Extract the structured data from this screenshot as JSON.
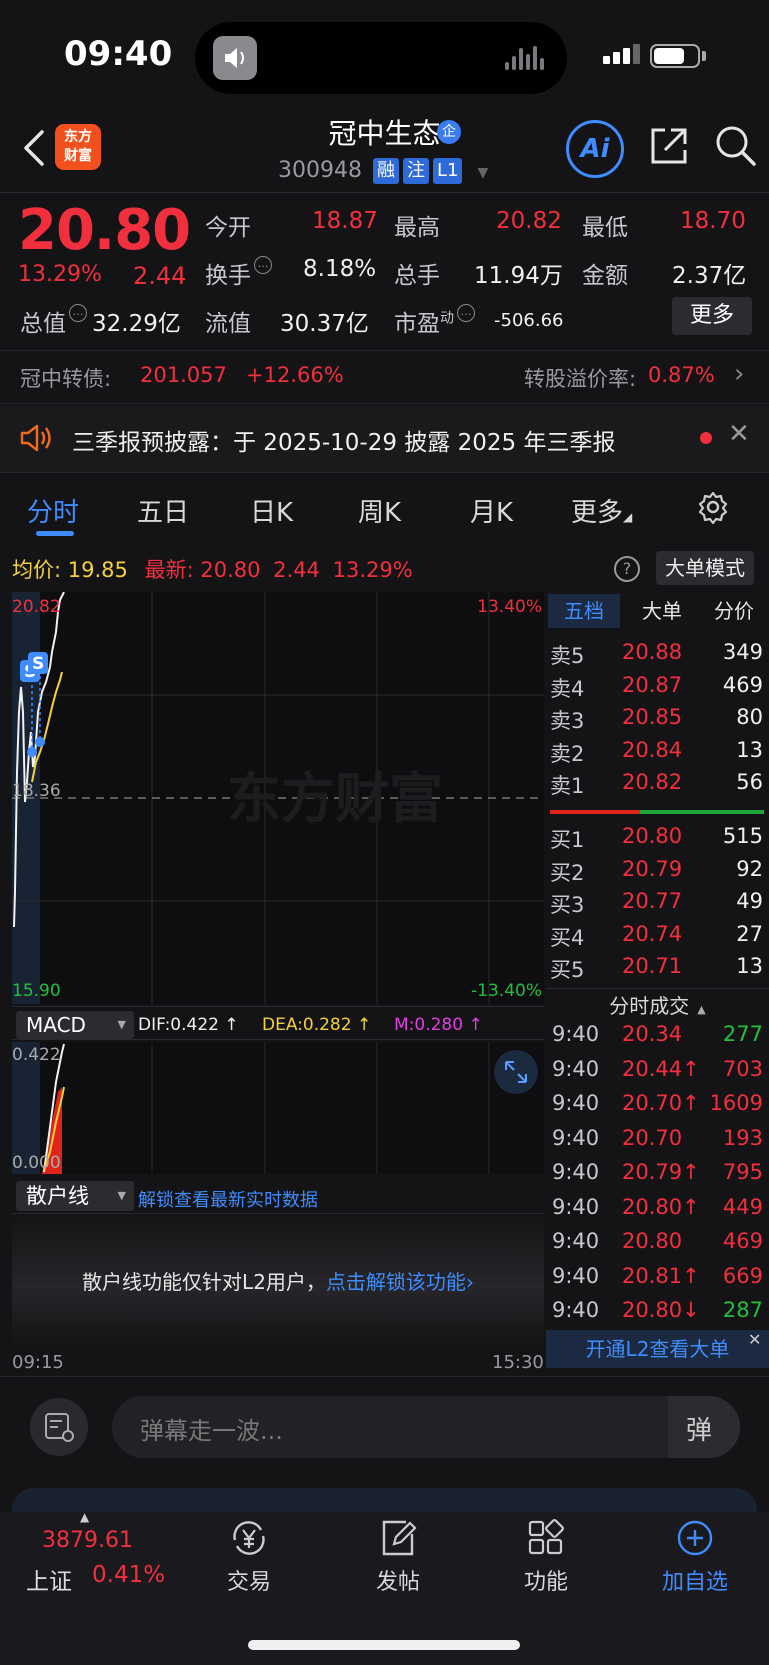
{
  "status_bar": {
    "time": "09:40"
  },
  "header": {
    "logo_text_1": "东方",
    "logo_text_2": "财富",
    "stock_name": "冠中生态",
    "badge": "企",
    "code": "300948",
    "tags": [
      "融",
      "注",
      "L1"
    ],
    "ai_label": "Ai"
  },
  "quote": {
    "price": "20.80",
    "change_pct": "13.29%",
    "change_amt": "2.44",
    "fields": {
      "open_label": "今开",
      "open": "18.87",
      "high_label": "最高",
      "high": "20.82",
      "low_label": "最低",
      "low": "18.70",
      "turnover_label": "换手",
      "turnover": "8.18%",
      "volume_label": "总手",
      "volume": "11.94万",
      "amount_label": "金额",
      "amount": "2.37亿",
      "mktcap_label": "总值",
      "mktcap": "32.29亿",
      "float_label": "流值",
      "float": "30.37亿",
      "pe_label": "市盈",
      "pe_sup": "动",
      "pe": "-506.66"
    },
    "more": "更多"
  },
  "convertible": {
    "label": "冠中转债:",
    "price": "201.057",
    "change": "+12.66%",
    "premium_label": "转股溢价率:",
    "premium": "0.87%"
  },
  "notice": {
    "text": "三季报预披露：于 2025-10-29 披露 2025 年三季报"
  },
  "tabs": [
    "分时",
    "五日",
    "日K",
    "周K",
    "月K",
    "更多"
  ],
  "chart": {
    "avg_label": "均价:",
    "avg": "19.85",
    "latest_label": "最新:",
    "latest": "20.80",
    "latest_chg": "2.44",
    "latest_pct": "13.29%",
    "mode_button": "大单模式",
    "y_top": "20.82",
    "y_mid": "18.36",
    "y_bottom": "15.90",
    "pct_top": "13.40%",
    "pct_bottom": "-13.40%",
    "watermark": "东方财富",
    "time_start": "09:15",
    "time_end": "15:30",
    "markers": [
      "S",
      "S"
    ]
  },
  "macd": {
    "selector": "MACD",
    "dif": "DIF:0.422 ↑",
    "dea": "DEA:0.282 ↑",
    "m": "M:0.280 ↑",
    "y_top": "0.422",
    "y_bottom": "0.000"
  },
  "retail": {
    "selector": "散户线",
    "unlock_link": "解锁查看最新实时数据",
    "locked_text": "散户线功能仅针对L2用户，",
    "locked_link": "点击解锁该功能"
  },
  "order_book": {
    "tabs": [
      "五档",
      "大单",
      "分价"
    ],
    "asks": [
      {
        "label": "卖5",
        "price": "20.88",
        "vol": "349"
      },
      {
        "label": "卖4",
        "price": "20.87",
        "vol": "469"
      },
      {
        "label": "卖3",
        "price": "20.85",
        "vol": "80"
      },
      {
        "label": "卖2",
        "price": "20.84",
        "vol": "13"
      },
      {
        "label": "卖1",
        "price": "20.82",
        "vol": "56"
      }
    ],
    "bids": [
      {
        "label": "买1",
        "price": "20.80",
        "vol": "515"
      },
      {
        "label": "买2",
        "price": "20.79",
        "vol": "92"
      },
      {
        "label": "买3",
        "price": "20.77",
        "vol": "49"
      },
      {
        "label": "买4",
        "price": "20.74",
        "vol": "27"
      },
      {
        "label": "买5",
        "price": "20.71",
        "vol": "13"
      }
    ],
    "ticks_title": "分时成交",
    "ticks": [
      {
        "time": "9:40",
        "price": "20.34",
        "vol": "277",
        "dir": "",
        "vcolor": "#1fc13a"
      },
      {
        "time": "9:40",
        "price": "20.44↑",
        "vol": "703",
        "dir": "",
        "vcolor": "#f2303d"
      },
      {
        "time": "9:40",
        "price": "20.70↑",
        "vol": "1609",
        "dir": "",
        "vcolor": "#f2303d"
      },
      {
        "time": "9:40",
        "price": "20.70",
        "vol": "193",
        "dir": "",
        "vcolor": "#f2303d"
      },
      {
        "time": "9:40",
        "price": "20.79↑",
        "vol": "795",
        "dir": "",
        "vcolor": "#f2303d"
      },
      {
        "time": "9:40",
        "price": "20.80↑",
        "vol": "449",
        "dir": "",
        "vcolor": "#f2303d"
      },
      {
        "time": "9:40",
        "price": "20.80",
        "vol": "469",
        "dir": "",
        "vcolor": "#f2303d"
      },
      {
        "time": "9:40",
        "price": "20.81↑",
        "vol": "669",
        "dir": "",
        "vcolor": "#f2303d"
      },
      {
        "time": "9:40",
        "price": "20.80↓",
        "vol": "287",
        "dir": "",
        "vcolor": "#1fc13a"
      }
    ],
    "l2_banner": "开通L2查看大单"
  },
  "danmu": {
    "placeholder": "弹幕走一波...",
    "send_icon": "弹"
  },
  "bottom_nav": {
    "index_value": "3879.61",
    "index_name": "上证",
    "index_pct": "0.41%",
    "items": [
      "交易",
      "发帖",
      "功能",
      "加自选"
    ]
  },
  "colors": {
    "up": "#f2303d",
    "down": "#1fc13a",
    "accent": "#3f8cff",
    "avg": "#f3d23a",
    "bg": "#141416"
  }
}
